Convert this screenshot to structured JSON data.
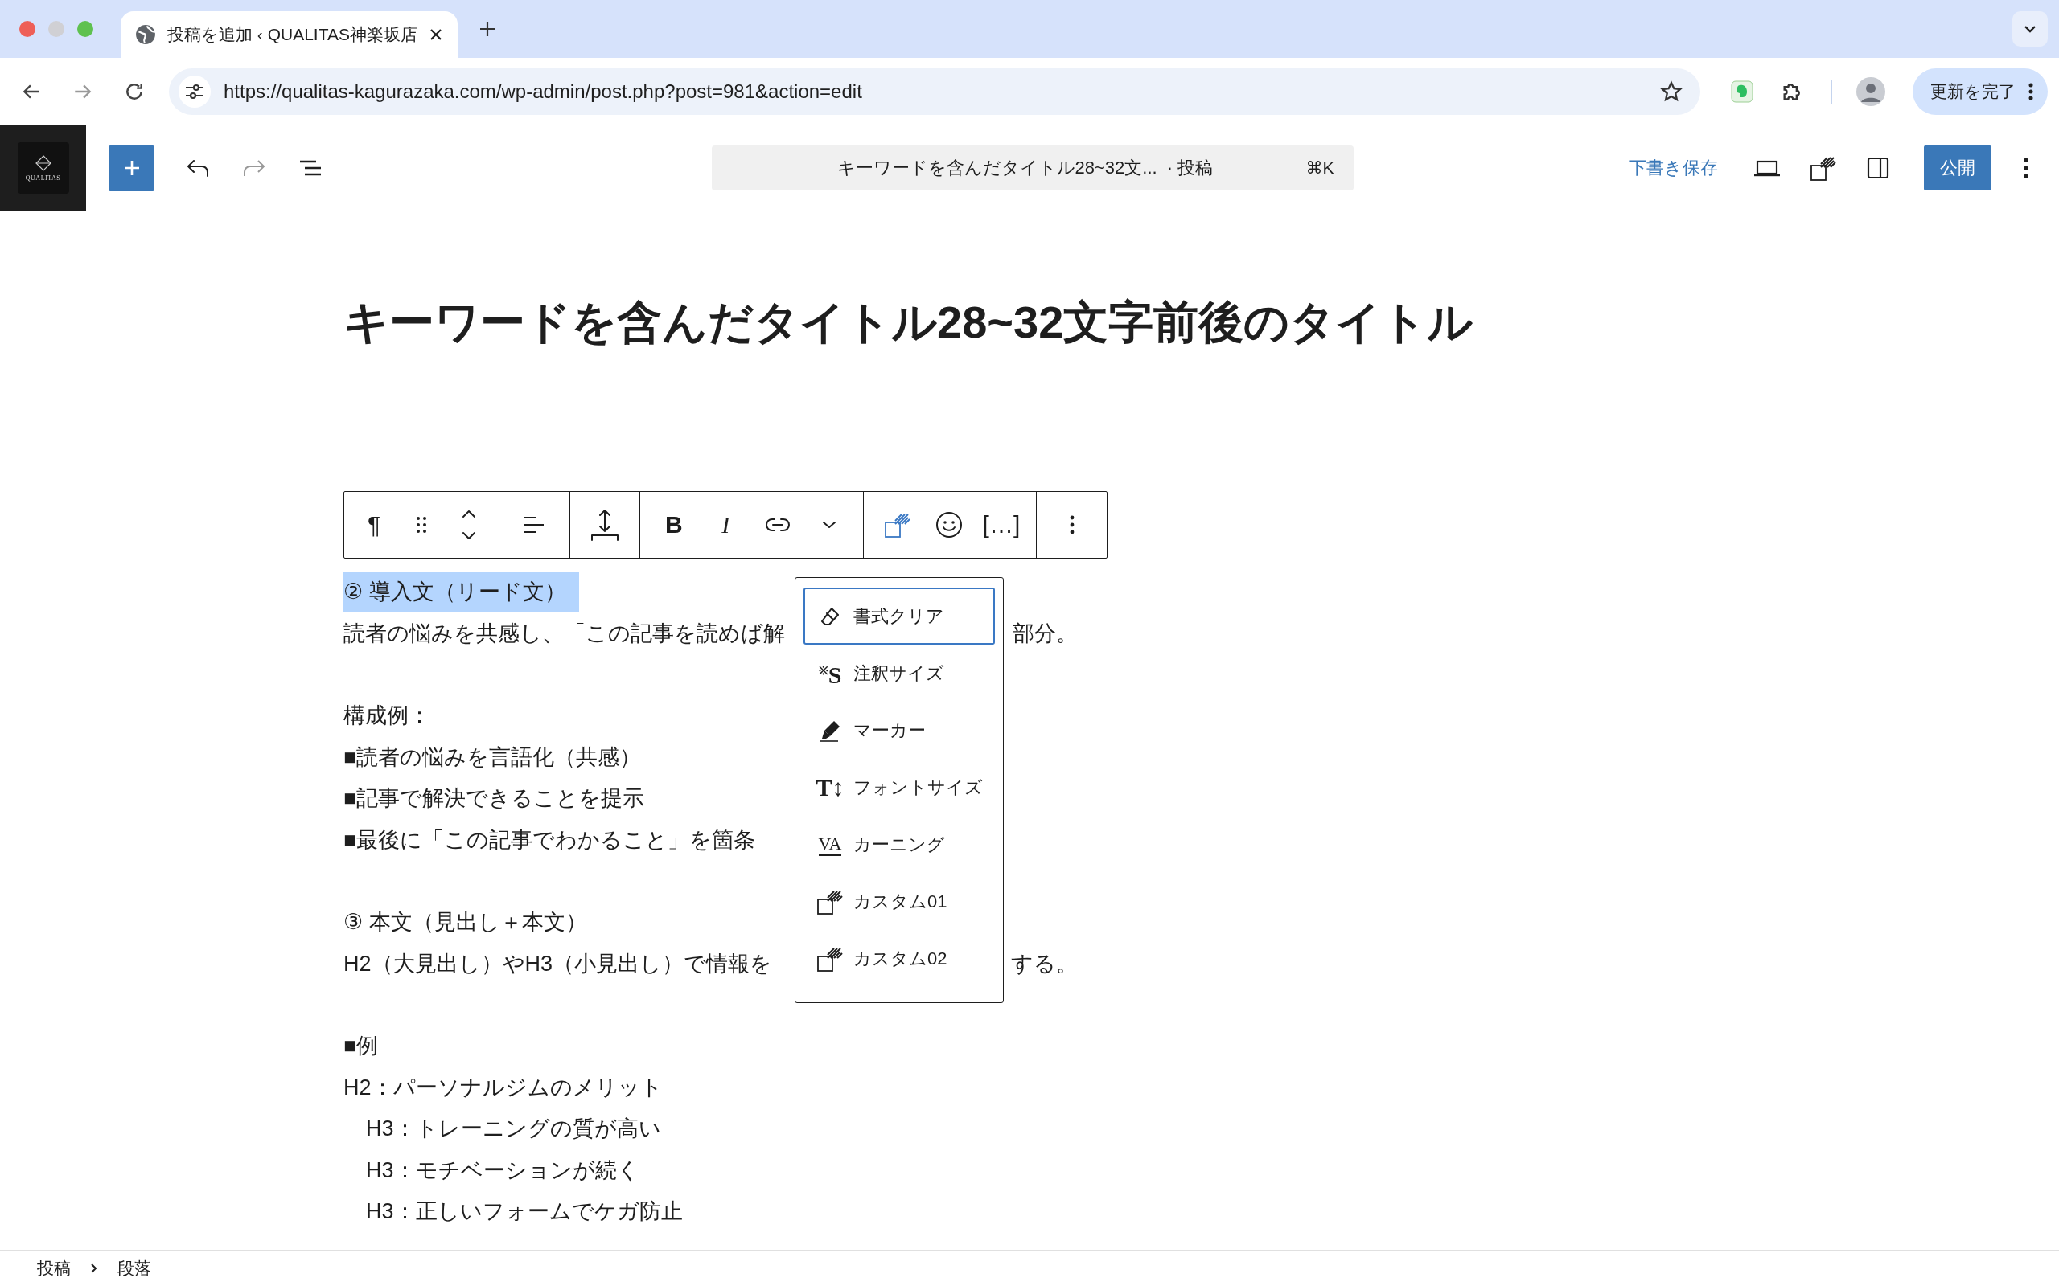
{
  "browser": {
    "tab_title": "投稿を追加 ‹ QUALITAS神楽坂店",
    "url": "https://qualitas-kagurazaka.com/wp-admin/post.php?post=981&action=edit",
    "update_button": "更新を完了"
  },
  "editor_header": {
    "logo_text": "QUALITAS",
    "command_title": "キーワードを含んだタイトル28~32文...",
    "command_type": "· 投稿",
    "shortcut": "⌘K",
    "save_draft": "下書き保存",
    "publish": "公開"
  },
  "post_title": "キーワードを含んだタイトル28~32文字前後のタイトル",
  "block_toolbar": {
    "groups": [
      [
        {
          "kind": "glyph",
          "glyph": "¶"
        },
        {
          "kind": "drag"
        },
        {
          "kind": "mover"
        }
      ],
      [
        {
          "kind": "align"
        }
      ],
      [
        {
          "kind": "valign"
        }
      ],
      [
        {
          "kind": "bold",
          "glyph": "B"
        },
        {
          "kind": "italic",
          "glyph": "I"
        },
        {
          "kind": "link"
        },
        {
          "kind": "chevron"
        }
      ],
      [
        {
          "kind": "format",
          "expanded": true
        },
        {
          "kind": "emoji"
        },
        {
          "kind": "glyph",
          "glyph": "[…]"
        }
      ],
      [
        {
          "kind": "more"
        }
      ]
    ]
  },
  "format_menu": {
    "items": [
      {
        "kind": "eraser",
        "label": "書式クリア",
        "selected": true
      },
      {
        "kind": "glyph",
        "glyph": "$^{※}$S",
        "label": "注釈サイズ",
        "selected": false
      },
      {
        "kind": "marker",
        "label": "マーカー",
        "selected": false
      },
      {
        "kind": "glyph",
        "glyph": "T↕",
        "label": "フォントサイズ",
        "selected": false
      },
      {
        "kind": "kerning",
        "glyph": "VA",
        "label": "カーニング",
        "selected": false
      },
      {
        "kind": "custom",
        "label": "カスタム01",
        "selected": false
      },
      {
        "kind": "custom",
        "label": "カスタム02",
        "selected": false
      }
    ]
  },
  "content": {
    "blocks": [
      {
        "lines": [
          {
            "text": "② 導入文（リード文）",
            "selected": true
          },
          {
            "text": "読者の悩みを共感し、「この記事を読めば解",
            "after": "部分。",
            "selected": false
          }
        ]
      },
      {
        "lines": [
          {
            "text": "構成例：",
            "selected": false
          },
          {
            "text": "■読者の悩みを言語化（共感）",
            "selected": false
          },
          {
            "text": "■記事で解決できることを提示",
            "selected": false
          },
          {
            "text": "■最後に「この記事でわかること」を箇条",
            "selected": false
          }
        ]
      },
      {
        "lines": [
          {
            "text": "③ 本文（見出し＋本文）",
            "selected": false
          },
          {
            "text": "H2（大見出し）やH3（小見出し）で情報を",
            "after": "する。",
            "selected": false
          }
        ]
      },
      {
        "lines": [
          {
            "text": "■例",
            "selected": false
          },
          {
            "text": "H2：パーソナルジムのメリット",
            "selected": false,
            "children": [
              {
                "text": "H3：トレーニングの質が高い",
                "selected": false
              },
              {
                "text": "H3：モチベーションが続く",
                "selected": false
              },
              {
                "text": "H3：正しいフォームでケガ防止",
                "selected": false
              }
            ]
          }
        ]
      }
    ]
  },
  "breadcrumbs": [
    "投稿",
    "段落"
  ]
}
